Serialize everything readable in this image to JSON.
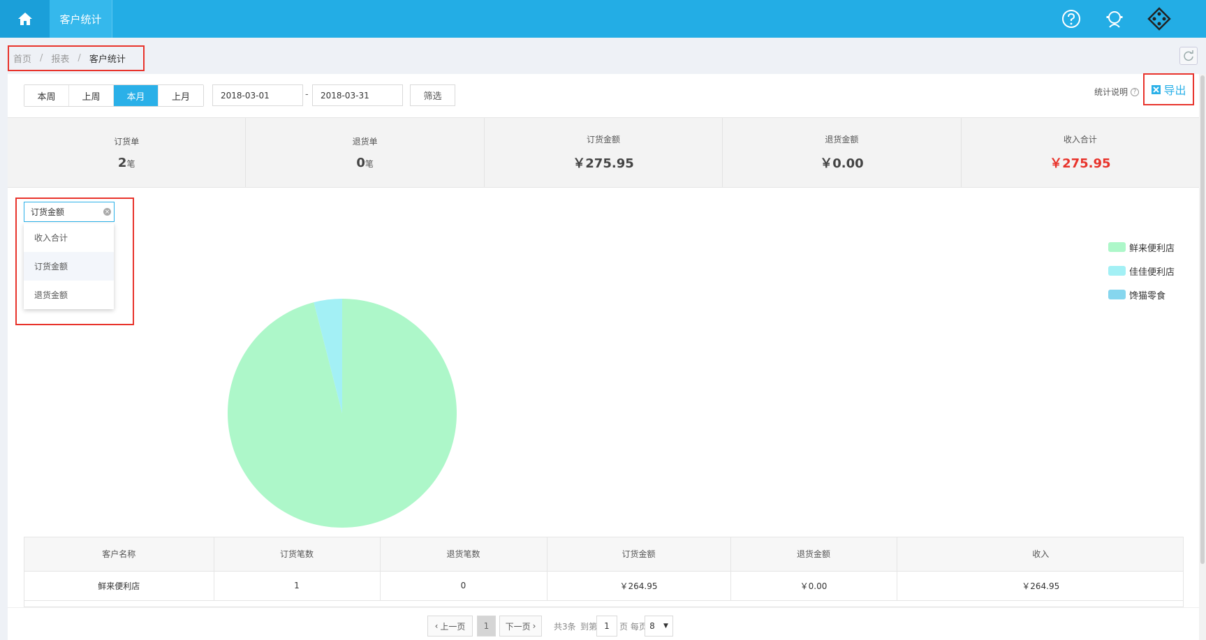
{
  "topbar": {
    "app_tab": "客户统计",
    "icons": [
      "home-icon",
      "help-icon",
      "support-icon",
      "apps-icon"
    ]
  },
  "breadcrumb": {
    "home": "首页",
    "reports": "报表",
    "current": "客户统计",
    "sep": "/"
  },
  "filters": {
    "periods": [
      "本周",
      "上周",
      "本月",
      "上月"
    ],
    "active_period": "本月",
    "date_start": "2018-03-01",
    "date_sep": "-",
    "date_end": "2018-03-31",
    "filter_label": "筛选",
    "stat_help_label": "统计说明",
    "help_mark": "?",
    "export_label": "导出"
  },
  "stats": [
    {
      "label": "订货单",
      "value": "2",
      "unit": "笔"
    },
    {
      "label": "退货单",
      "value": "0",
      "unit": "笔"
    },
    {
      "label": "订货金额",
      "value": "￥275.95",
      "unit": ""
    },
    {
      "label": "退货金额",
      "value": "￥0.00",
      "unit": ""
    },
    {
      "label": "收入合计",
      "value": "￥275.95",
      "unit": ""
    }
  ],
  "metric_select": {
    "selected": "订货金额",
    "clear_mark": "×",
    "options": [
      "收入合计",
      "订货金额",
      "退货金额"
    ]
  },
  "chart_data": {
    "type": "pie",
    "labels": [
      "鲜来便利店",
      "佳佳便利店",
      "馋猫零食"
    ],
    "values": [
      264.95,
      11.0,
      0
    ],
    "colors": [
      "#adf7c9",
      "#a3f0f5",
      "#86d6ee"
    ]
  },
  "table": {
    "headers": [
      "客户名称",
      "订货笔数",
      "退货笔数",
      "订货金额",
      "退货金额",
      "收入"
    ],
    "rows": [
      [
        "鲜来便利店",
        "1",
        "0",
        "￥264.95",
        "￥0.00",
        "￥264.95"
      ]
    ]
  },
  "pagination": {
    "prev": "上一页",
    "current_page": "1",
    "next": "下一页",
    "total": "共3条",
    "goto_label": "到第",
    "goto_value": "1",
    "per_page_label": "页 每页",
    "per_page_value": "8",
    "dropdown_mark": "▼"
  }
}
